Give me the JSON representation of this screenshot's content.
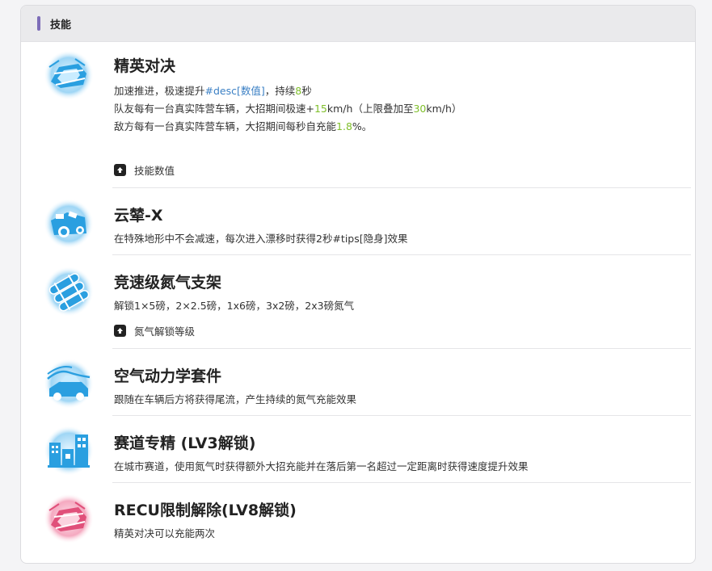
{
  "header": {
    "title": "技能"
  },
  "skills": [
    {
      "name": "精英对决",
      "icon": "car-boost-icon",
      "lines": [
        {
          "parts": [
            "加速推进，极速提升",
            "#desc[数值]",
            "，持续",
            "8",
            "秒"
          ]
        },
        {
          "parts": [
            "队友每有一台真实阵营车辆，大招期间极速+",
            "15",
            "km/h（上限叠加至",
            "30",
            "km/h）"
          ]
        },
        {
          "parts": [
            "敌方每有一台真实阵营车辆，大招期间每秒自充能",
            "1.8",
            "%。"
          ]
        }
      ],
      "toggle": "技能数值"
    },
    {
      "name": "云辇-X",
      "icon": "car-drift-icon",
      "lines": [
        {
          "text": "在特殊地形中不会减速，每次进入漂移时获得2秒#tips[隐身]效果"
        }
      ]
    },
    {
      "name": "竞速级氮气支架",
      "icon": "nitro-tanks-icon",
      "lines": [
        {
          "text": "解锁1×5磅，2×2.5磅，1x6磅，3x2磅，2x3磅氮气"
        }
      ],
      "toggle": "氮气解锁等级"
    },
    {
      "name": "空气动力学套件",
      "icon": "aero-kit-icon",
      "lines": [
        {
          "text": "跟随在车辆后方将获得尾流，产生持续的氮气充能效果"
        }
      ]
    },
    {
      "name": "赛道专精 (LV3解锁)",
      "icon": "city-track-icon",
      "lines": [
        {
          "text": "在城市赛道，使用氮气时获得额外大招充能并在落后第一名超过一定距离时获得速度提升效果"
        }
      ]
    },
    {
      "name": "RECU限制解除(LV8解锁)",
      "icon": "car-boost-red-icon",
      "lines": [
        {
          "text": "精英对决可以充能两次"
        }
      ]
    }
  ],
  "colors": {
    "accent": "#7d6db8",
    "highlight": "#7fbf2a",
    "link": "#3a7fc4",
    "icon_blue": "#2a9fe0",
    "icon_red": "#e0507a"
  }
}
